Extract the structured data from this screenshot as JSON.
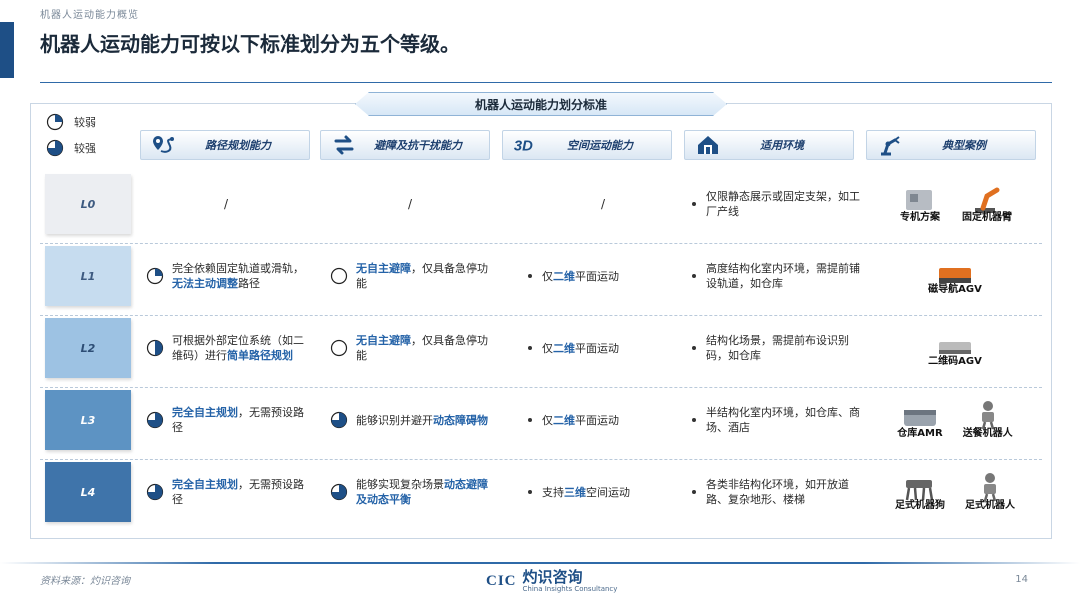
{
  "section_label": "机器人运动能力概览",
  "headline": "机器人运动能力可按以下标准划分为五个等级。",
  "panel_title": "机器人运动能力划分标准",
  "legend": [
    {
      "label": "较弱",
      "fill": "quarter"
    },
    {
      "label": "较强",
      "fill": "three-quarter"
    }
  ],
  "columns": [
    {
      "label": "路径规划能力",
      "icon": "route-pin-icon"
    },
    {
      "label": "避障及抗干扰能力",
      "icon": "swap-arrows-icon"
    },
    {
      "label": "空间运动能力",
      "icon": "3d-icon"
    },
    {
      "label": "适用环境",
      "icon": "house-icon"
    },
    {
      "label": "典型案例",
      "icon": "robot-arm-icon"
    }
  ],
  "rows": [
    {
      "level": "L0",
      "path": {
        "pie": "none",
        "pre": "/",
        "hl": "",
        "post": ""
      },
      "avoid": {
        "pie": "none",
        "pre": "/",
        "hl": "",
        "post": ""
      },
      "space": {
        "bullet": false,
        "pre": "/",
        "hl": "",
        "post": ""
      },
      "env": "仅限静态展示或固定支架，如工厂产线",
      "cases": [
        "专机方案",
        "固定机器臂"
      ]
    },
    {
      "level": "L1",
      "path": {
        "pie": "quarter",
        "pre": "完全依赖固定轨道或滑轨，",
        "hl": "无法主动调整",
        "post": "路径"
      },
      "avoid": {
        "pie": "empty",
        "pre": "",
        "hl": "无自主避障",
        "post": "，仅具备急停功能"
      },
      "space": {
        "bullet": true,
        "pre": "仅",
        "hl": "二维",
        "post": "平面运动"
      },
      "env": "高度结构化室内环境，需提前铺设轨道，如仓库",
      "cases": [
        "磁导航AGV"
      ]
    },
    {
      "level": "L2",
      "path": {
        "pie": "half",
        "pre": "可根据外部定位系统（如二维码）进行",
        "hl": "简单路径规划",
        "post": ""
      },
      "avoid": {
        "pie": "empty",
        "pre": "",
        "hl": "无自主避障",
        "post": "，仅具备急停功能"
      },
      "space": {
        "bullet": true,
        "pre": "仅",
        "hl": "二维",
        "post": "平面运动"
      },
      "env": "结构化场景，需提前布设识别码，如仓库",
      "cases": [
        "二维码AGV"
      ]
    },
    {
      "level": "L3",
      "path": {
        "pie": "three-quarter",
        "pre": "",
        "hl": "完全自主规划",
        "post": "，无需预设路径"
      },
      "avoid": {
        "pie": "three-quarter",
        "pre": "能够识别并避开",
        "hl": "动态障碍物",
        "post": ""
      },
      "space": {
        "bullet": true,
        "pre": "仅",
        "hl": "二维",
        "post": "平面运动"
      },
      "env": "半结构化室内环境，如仓库、商场、酒店",
      "cases": [
        "仓库AMR",
        "送餐机器人"
      ]
    },
    {
      "level": "L4",
      "path": {
        "pie": "three-quarter",
        "pre": "",
        "hl": "完全自主规划",
        "post": "，无需预设路径"
      },
      "avoid": {
        "pie": "three-quarter",
        "pre": "能够实现复杂场景",
        "hl": "动态避障及动态平衡",
        "post": ""
      },
      "space": {
        "bullet": true,
        "pre": "支持",
        "hl": "三维",
        "post": "空间运动"
      },
      "env": "各类非结构化环境，如开放道路、复杂地形、楼梯",
      "cases": [
        "足式机器狗",
        "足式机器人"
      ]
    }
  ],
  "level_colors": [
    "#eceef2",
    "#c6dcef",
    "#9dc2e3",
    "#5d93c3",
    "#3f74aa"
  ],
  "level_text_colors": [
    "#3d5a80",
    "#3d5a80",
    "#2d4d75",
    "#ffffff",
    "#ffffff"
  ],
  "footer": {
    "source": "资料来源：灼识咨询",
    "page": "14",
    "logo_mark": "CIC",
    "logo_cn": "灼识咨询",
    "logo_en": "China Insights Consultancy"
  },
  "colors": {
    "accent": "#1e4f86",
    "highlight": "#2563a8",
    "pie": "#1e4f86"
  }
}
